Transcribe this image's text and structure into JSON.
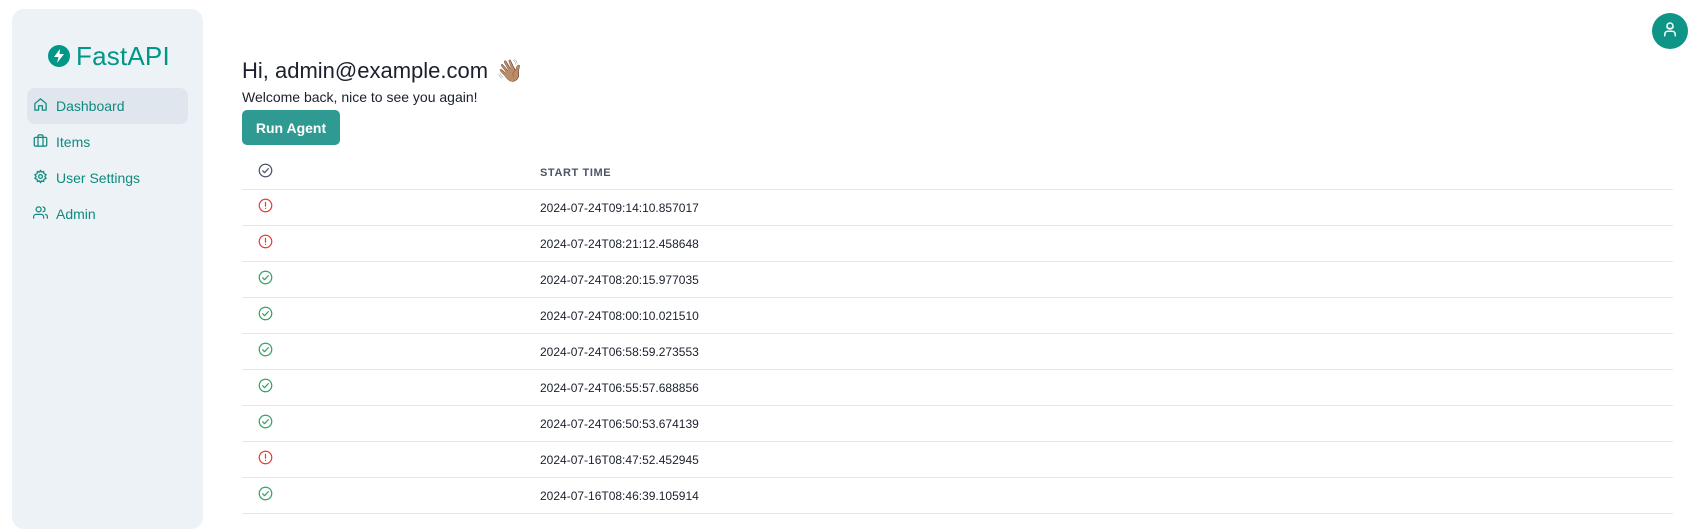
{
  "brand": {
    "name": "FastAPI"
  },
  "sidebar": {
    "items": [
      {
        "label": "Dashboard",
        "icon": "home-icon",
        "active": true
      },
      {
        "label": "Items",
        "icon": "briefcase-icon",
        "active": false
      },
      {
        "label": "User Settings",
        "icon": "gear-icon",
        "active": false
      },
      {
        "label": "Admin",
        "icon": "users-icon",
        "active": false
      }
    ]
  },
  "header": {
    "user_menu_icon": "user-avatar-icon"
  },
  "main": {
    "greeting": "Hi, admin@example.com",
    "greeting_emoji": "👋🏽",
    "welcome": "Welcome back, nice to see you again!",
    "run_agent_label": "Run Agent"
  },
  "table": {
    "header_status_icon": "check-circle-icon",
    "header_time": "START TIME",
    "rows": [
      {
        "status": "error",
        "start_time": "2024-07-24T09:14:10.857017"
      },
      {
        "status": "error",
        "start_time": "2024-07-24T08:21:12.458648"
      },
      {
        "status": "success",
        "start_time": "2024-07-24T08:20:15.977035"
      },
      {
        "status": "success",
        "start_time": "2024-07-24T08:00:10.021510"
      },
      {
        "status": "success",
        "start_time": "2024-07-24T06:58:59.273553"
      },
      {
        "status": "success",
        "start_time": "2024-07-24T06:55:57.688856"
      },
      {
        "status": "success",
        "start_time": "2024-07-24T06:50:53.674139"
      },
      {
        "status": "error",
        "start_time": "2024-07-16T08:47:52.452945"
      },
      {
        "status": "success",
        "start_time": "2024-07-16T08:46:39.105914"
      }
    ]
  },
  "colors": {
    "accent": "#009688",
    "button": "#2f9a91",
    "success": "#38a169",
    "error": "#e53e3e",
    "sidebar_bg": "#edf2f7"
  }
}
